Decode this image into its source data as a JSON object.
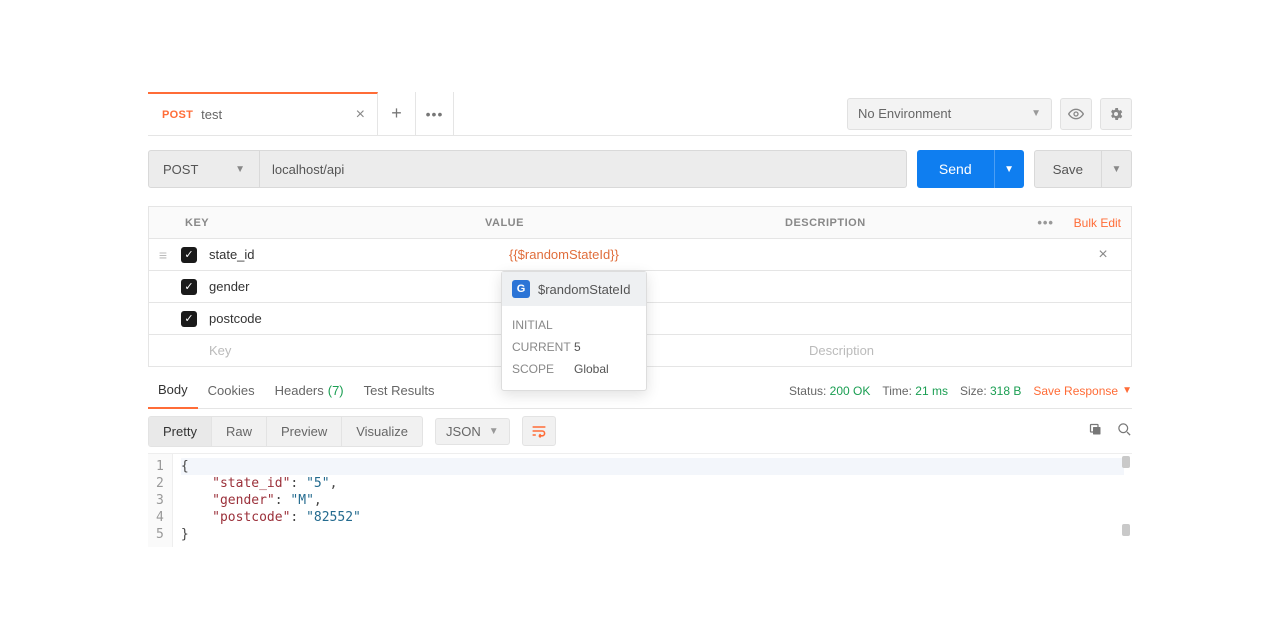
{
  "tab": {
    "method": "POST",
    "title": "test"
  },
  "env": {
    "selected": "No Environment"
  },
  "request": {
    "method": "POST",
    "url": "localhost/api",
    "send": "Send",
    "save": "Save"
  },
  "headers": {
    "key": "KEY",
    "value": "VALUE",
    "desc": "DESCRIPTION",
    "bulk": "Bulk Edit"
  },
  "params": [
    {
      "checked": true,
      "key": "state_id",
      "value": "{{$randomStateId}}",
      "active": true
    },
    {
      "checked": true,
      "key": "gender",
      "value": ""
    },
    {
      "checked": true,
      "key": "postcode",
      "value": ""
    }
  ],
  "newrow": {
    "key": "Key",
    "desc": "Description"
  },
  "popup": {
    "name": "$randomStateId",
    "initial_label": "INITIAL",
    "current_label": "CURRENT",
    "current_value": "5",
    "scope_label": "SCOPE",
    "scope_value": "Global"
  },
  "resp_tabs": {
    "body": "Body",
    "cookies": "Cookies",
    "headers": "Headers",
    "headers_count": "(7)",
    "tests": "Test Results"
  },
  "status": {
    "status_label": "Status:",
    "status_value": "200 OK",
    "time_label": "Time:",
    "time_value": "21 ms",
    "size_label": "Size:",
    "size_value": "318 B",
    "save": "Save Response"
  },
  "view": {
    "pretty": "Pretty",
    "raw": "Raw",
    "preview": "Preview",
    "visualize": "Visualize",
    "format": "JSON"
  },
  "code": {
    "lines": [
      "1",
      "2",
      "3",
      "4",
      "5"
    ],
    "body": {
      "l1": "{",
      "l2_key": "\"state_id\"",
      "l2_val": "\"5\"",
      "l3_key": "\"gender\"",
      "l3_val": "\"M\"",
      "l4_key": "\"postcode\"",
      "l4_val": "\"82552\"",
      "l5": "}"
    }
  }
}
